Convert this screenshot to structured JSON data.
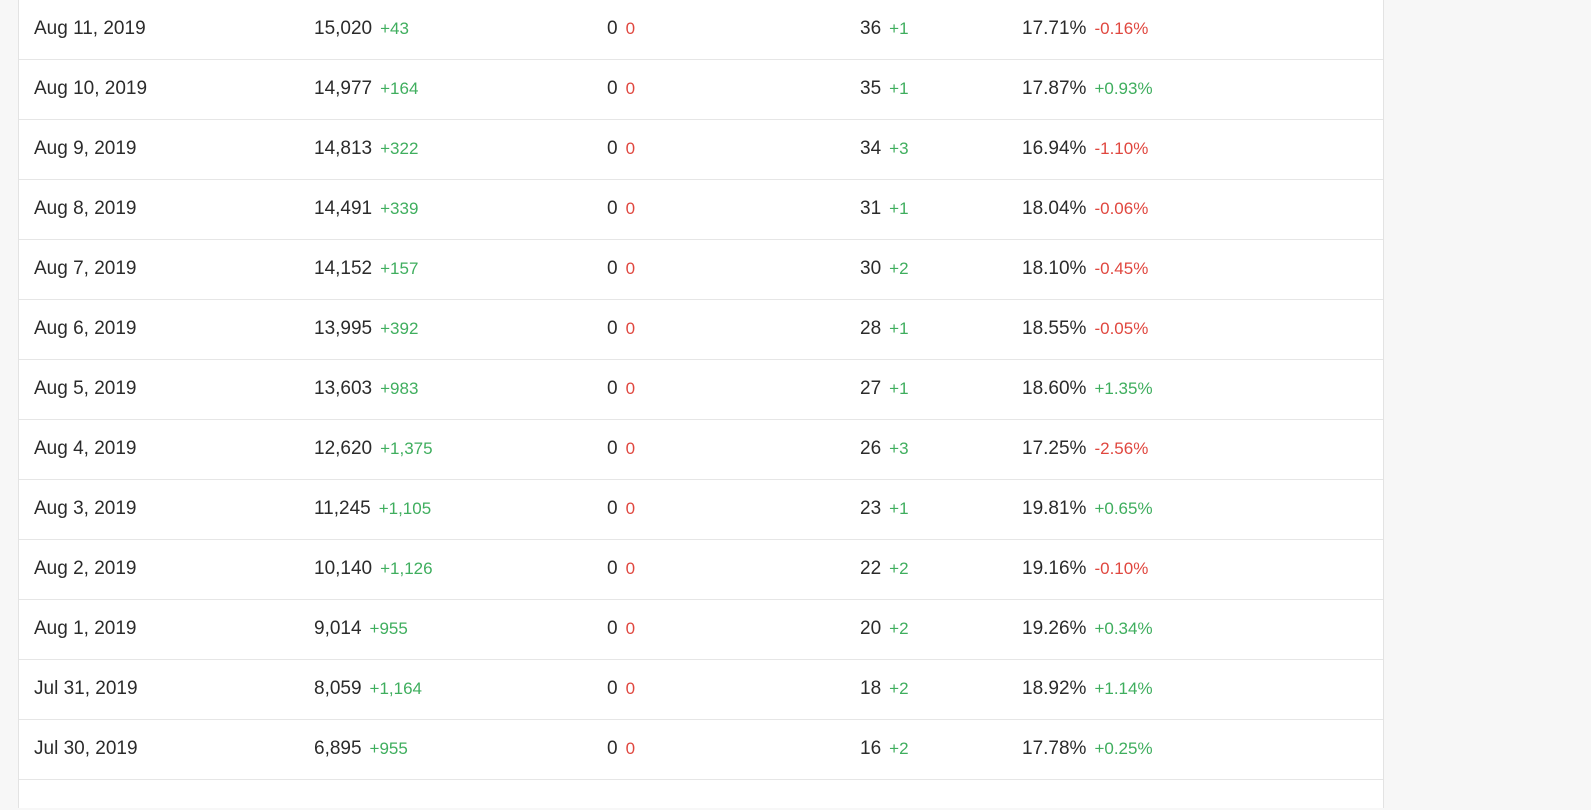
{
  "colors": {
    "positive": "#3fae5e",
    "negative": "#e0473f",
    "text": "#2b2b2b",
    "background": "#f7f7f7",
    "panel": "#ffffff"
  },
  "rows": [
    {
      "date": "Aug 11, 2019",
      "views": "15,020",
      "views_delta": "+43",
      "zero": "0",
      "zero_delta": "0",
      "count": "36",
      "count_delta": "+1",
      "pct": "17.71%",
      "pct_delta": "-0.16%"
    },
    {
      "date": "Aug 10, 2019",
      "views": "14,977",
      "views_delta": "+164",
      "zero": "0",
      "zero_delta": "0",
      "count": "35",
      "count_delta": "+1",
      "pct": "17.87%",
      "pct_delta": "+0.93%"
    },
    {
      "date": "Aug 9, 2019",
      "views": "14,813",
      "views_delta": "+322",
      "zero": "0",
      "zero_delta": "0",
      "count": "34",
      "count_delta": "+3",
      "pct": "16.94%",
      "pct_delta": "-1.10%"
    },
    {
      "date": "Aug 8, 2019",
      "views": "14,491",
      "views_delta": "+339",
      "zero": "0",
      "zero_delta": "0",
      "count": "31",
      "count_delta": "+1",
      "pct": "18.04%",
      "pct_delta": "-0.06%"
    },
    {
      "date": "Aug 7, 2019",
      "views": "14,152",
      "views_delta": "+157",
      "zero": "0",
      "zero_delta": "0",
      "count": "30",
      "count_delta": "+2",
      "pct": "18.10%",
      "pct_delta": "-0.45%"
    },
    {
      "date": "Aug 6, 2019",
      "views": "13,995",
      "views_delta": "+392",
      "zero": "0",
      "zero_delta": "0",
      "count": "28",
      "count_delta": "+1",
      "pct": "18.55%",
      "pct_delta": "-0.05%"
    },
    {
      "date": "Aug 5, 2019",
      "views": "13,603",
      "views_delta": "+983",
      "zero": "0",
      "zero_delta": "0",
      "count": "27",
      "count_delta": "+1",
      "pct": "18.60%",
      "pct_delta": "+1.35%"
    },
    {
      "date": "Aug 4, 2019",
      "views": "12,620",
      "views_delta": "+1,375",
      "zero": "0",
      "zero_delta": "0",
      "count": "26",
      "count_delta": "+3",
      "pct": "17.25%",
      "pct_delta": "-2.56%"
    },
    {
      "date": "Aug 3, 2019",
      "views": "11,245",
      "views_delta": "+1,105",
      "zero": "0",
      "zero_delta": "0",
      "count": "23",
      "count_delta": "+1",
      "pct": "19.81%",
      "pct_delta": "+0.65%"
    },
    {
      "date": "Aug 2, 2019",
      "views": "10,140",
      "views_delta": "+1,126",
      "zero": "0",
      "zero_delta": "0",
      "count": "22",
      "count_delta": "+2",
      "pct": "19.16%",
      "pct_delta": "-0.10%"
    },
    {
      "date": "Aug 1, 2019",
      "views": "9,014",
      "views_delta": "+955",
      "zero": "0",
      "zero_delta": "0",
      "count": "20",
      "count_delta": "+2",
      "pct": "19.26%",
      "pct_delta": "+0.34%"
    },
    {
      "date": "Jul 31, 2019",
      "views": "8,059",
      "views_delta": "+1,164",
      "zero": "0",
      "zero_delta": "0",
      "count": "18",
      "count_delta": "+2",
      "pct": "18.92%",
      "pct_delta": "+1.14%"
    },
    {
      "date": "Jul 30, 2019",
      "views": "6,895",
      "views_delta": "+955",
      "zero": "0",
      "zero_delta": "0",
      "count": "16",
      "count_delta": "+2",
      "pct": "17.78%",
      "pct_delta": "+0.25%"
    }
  ]
}
